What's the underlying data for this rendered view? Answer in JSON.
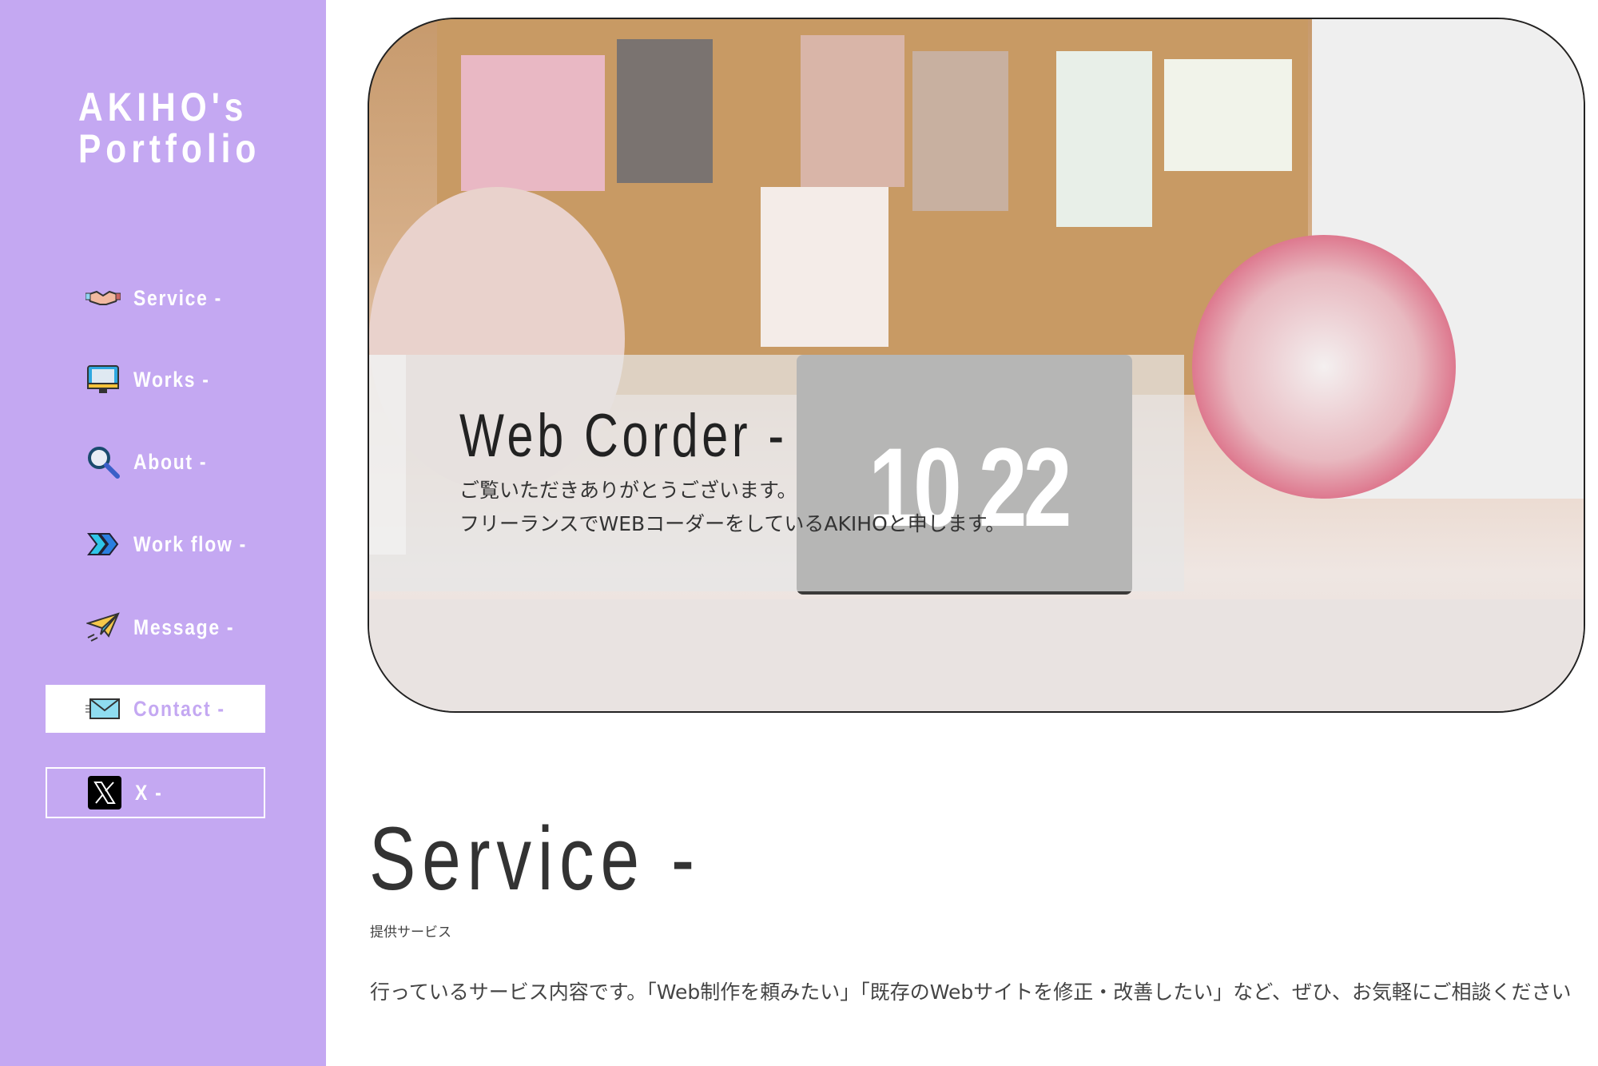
{
  "sidebar": {
    "logo": "AKIHO's Portfolio",
    "logo_line1": "AKIHO's",
    "logo_line2": "Portfolio",
    "background_color": "#c4a8f2",
    "items": [
      {
        "label": "Service -",
        "icon": "handshake-icon"
      },
      {
        "label": "Works -",
        "icon": "monitor-icon"
      },
      {
        "label": "About -",
        "icon": "magnifier-icon"
      },
      {
        "label": "Work flow -",
        "icon": "double-chevron-icon"
      },
      {
        "label": "Message -",
        "icon": "paper-plane-icon"
      },
      {
        "label": "Contact -",
        "icon": "envelope-icon"
      },
      {
        "label": "X -",
        "icon": "x-logo-icon"
      }
    ]
  },
  "hero": {
    "title": "Web Corder -",
    "line1": "ご覧いただきありがとうございます。",
    "line2": "フリーランスでWEBコーダーをしているAKIHOと申します。",
    "clock": "10 22"
  },
  "service": {
    "title": "Service -",
    "subtitle": "提供サービス",
    "text": "行っているサービス内容です。「Web制作を頼みたい」「既存のWebサイトを修正・改善したい」など、ぜひ、お気軽にご相談ください"
  }
}
